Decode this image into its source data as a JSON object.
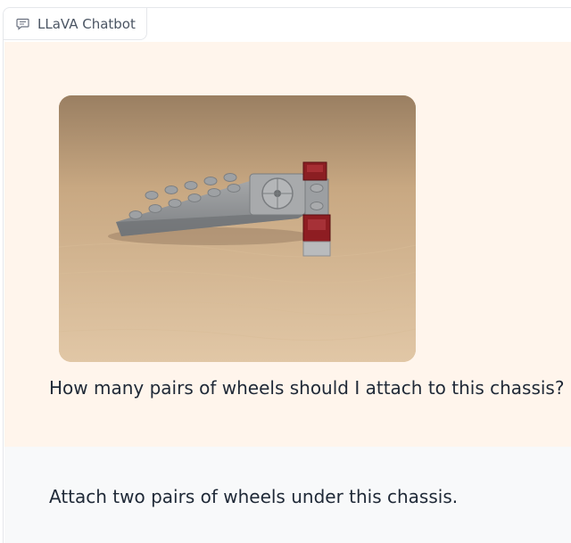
{
  "chatbot": {
    "label": "LLaVA Chatbot",
    "label_icon": "chat-bubble-icon"
  },
  "messages": [
    {
      "role": "user",
      "image_alt": "Gray LEGO plate chassis with red bricks on wooden table",
      "text": "How many pairs of wheels should I attach to this chassis?"
    },
    {
      "role": "bot",
      "text": "Attach two pairs of wheels under this chassis."
    }
  ],
  "colors": {
    "user_bubble": "#fff5ec",
    "bot_bubble": "#f8f9fa",
    "text": "#1f2937"
  }
}
